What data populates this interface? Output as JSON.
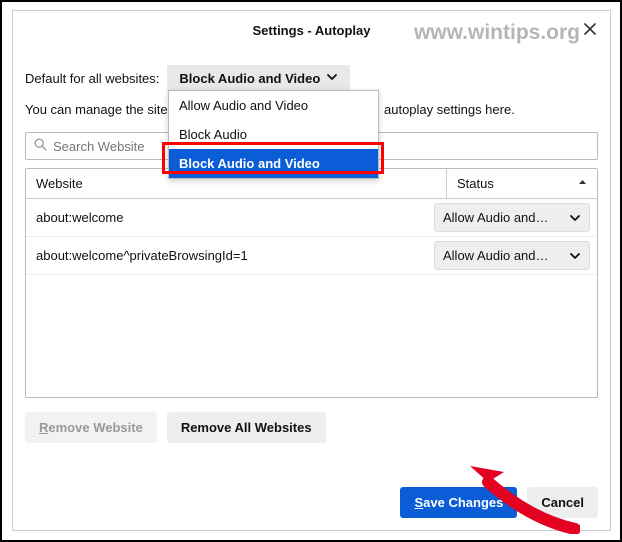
{
  "titlebar": {
    "title": "Settings - Autoplay"
  },
  "watermark": "www.wintips.org",
  "defaultRow": {
    "label": "Default for all websites:",
    "selected": "Block Audio and Video",
    "options": [
      "Allow Audio and Video",
      "Block Audio",
      "Block Audio and Video"
    ]
  },
  "descriptionRow": {
    "partA": "You can manage the sites",
    "partB": "autoplay settings here."
  },
  "search": {
    "placeholder": "Search Website"
  },
  "table": {
    "columns": {
      "website": "Website",
      "status": "Status"
    },
    "rows": [
      {
        "website": "about:welcome",
        "status": "Allow Audio and Video",
        "statusDisplay": "Allow Audio and…"
      },
      {
        "website": "about:welcome^privateBrowsingId=1",
        "status": "Allow Audio and Video",
        "statusDisplay": "Allow Audio and…"
      }
    ]
  },
  "buttons": {
    "removeWebsite": "Remove Website",
    "removeWebsiteRest": "emove Website",
    "removeAll": "Remove All Websites",
    "save": "Save Changes",
    "saveRest": "ave Changes",
    "cancel": "Cancel"
  }
}
